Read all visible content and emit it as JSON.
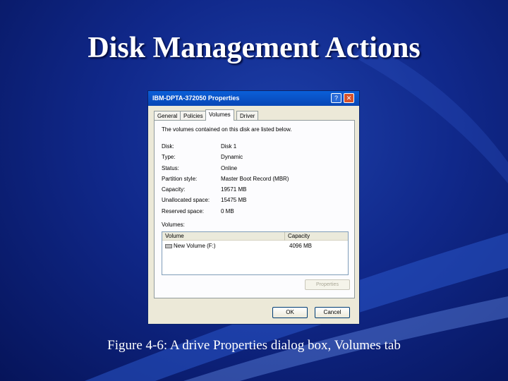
{
  "slide": {
    "title": "Disk Management Actions",
    "caption": "Figure 4-6: A drive Properties dialog box, Volumes tab"
  },
  "dialog": {
    "title": "IBM-DPTA-372050 Properties",
    "help_glyph": "?",
    "close_glyph": "✕",
    "tabs": [
      {
        "label": "General",
        "active": false
      },
      {
        "label": "Policies",
        "active": false
      },
      {
        "label": "Volumes",
        "active": true
      },
      {
        "label": "Driver",
        "active": false
      }
    ],
    "intro": "The volumes contained on this disk are listed below.",
    "info": [
      {
        "label": "Disk:",
        "value": "Disk 1"
      },
      {
        "label": "Type:",
        "value": "Dynamic"
      },
      {
        "label": "Status:",
        "value": "Online"
      },
      {
        "label": "Partition style:",
        "value": "Master Boot Record (MBR)"
      },
      {
        "label": "Capacity:",
        "value": "19571 MB"
      },
      {
        "label": "Unallocated space:",
        "value": "15475 MB"
      },
      {
        "label": "Reserved space:",
        "value": "0 MB"
      }
    ],
    "volumes_label": "Volumes:",
    "columns": {
      "volume": "Volume",
      "capacity": "Capacity"
    },
    "volumes": [
      {
        "name": "New Volume (F:)",
        "capacity": "4096 MB"
      }
    ],
    "properties_button": "Properties",
    "ok_button": "OK",
    "cancel_button": "Cancel"
  }
}
